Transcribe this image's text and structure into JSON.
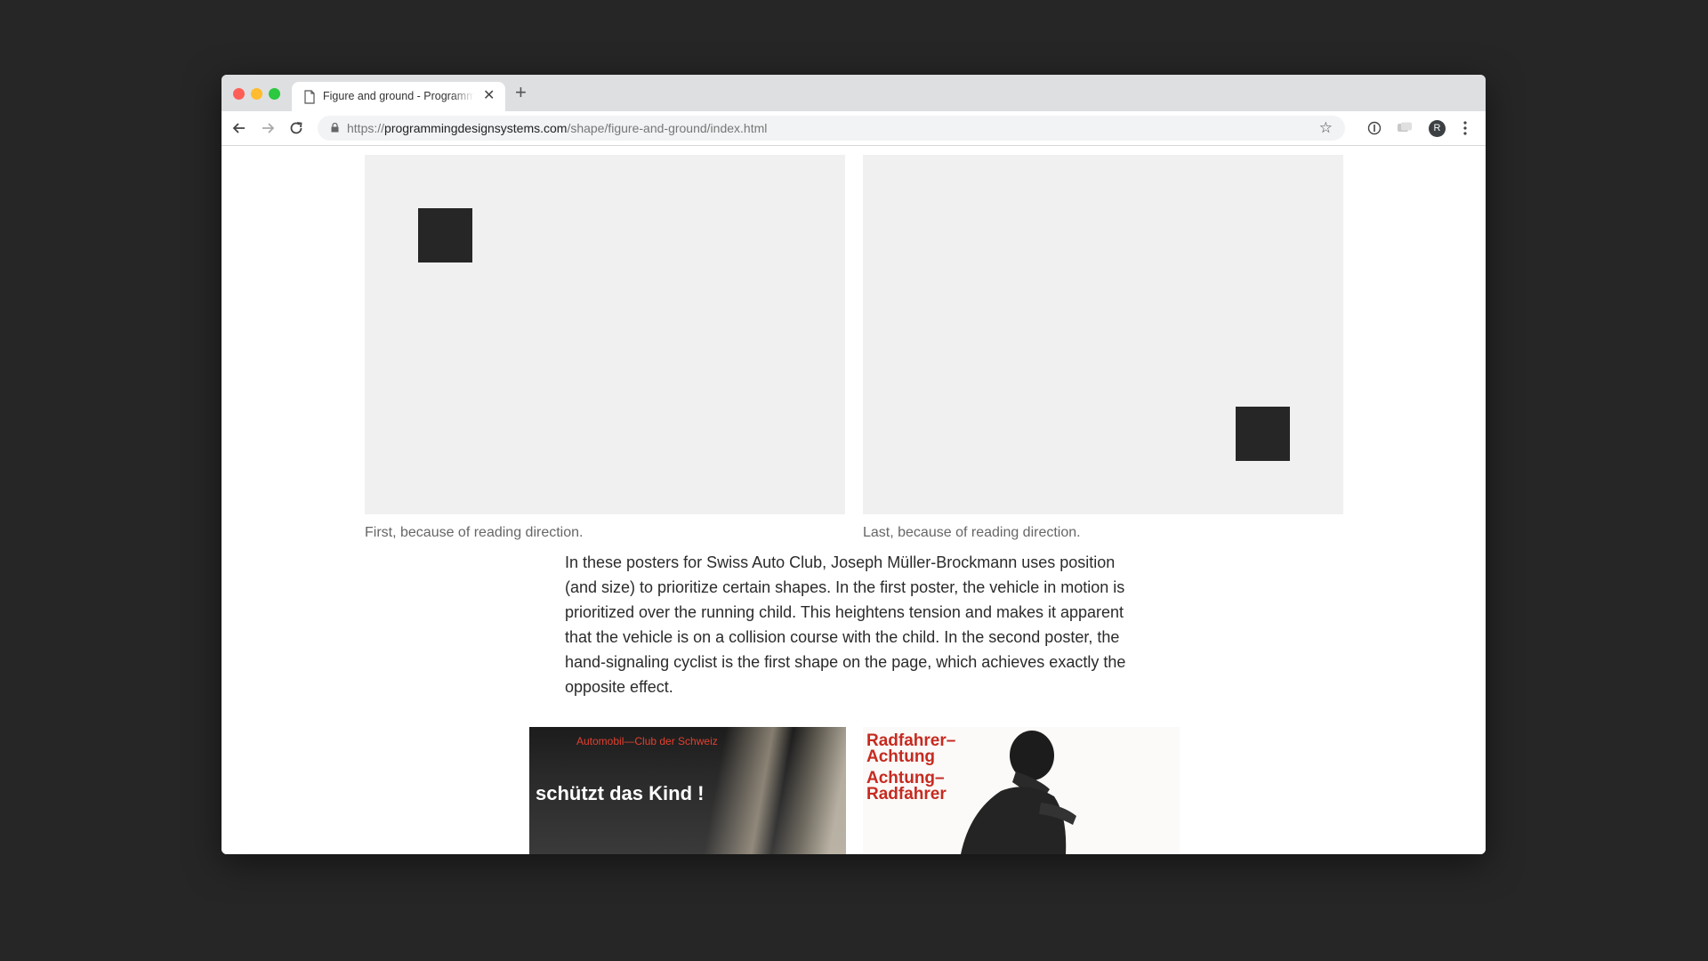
{
  "browser": {
    "tab": {
      "title": "Figure and ground - Programming Design Systems",
      "icon": "document-icon",
      "close_icon": "close-icon"
    },
    "new_tab_label": "+",
    "nav": {
      "back_icon": "back-arrow-icon",
      "forward_icon": "forward-arrow-icon",
      "reload_icon": "reload-icon"
    },
    "url": {
      "scheme": "https://",
      "host": "programmingdesignsystems.com",
      "path": "/shape/figure-and-ground/index.html"
    },
    "bookmark_icon": "star-icon",
    "star_glyph": "☆",
    "avatar_initial": "R",
    "colors": {
      "tab_strip": "#dedfe1",
      "omnibox": "#f1f3f4",
      "page_bg": "#262626"
    }
  },
  "page": {
    "figures": [
      {
        "caption": "First, because of reading direction."
      },
      {
        "caption": "Last, because of reading direction."
      }
    ],
    "paragraph": "In these posters for Swiss Auto Club, Joseph Müller-Brockmann uses position (and size) to prioritize certain shapes. In the first poster, the vehicle in motion is prioritized over the running child. This heightens tension and makes it apparent that the vehicle is on a collision course with the child. In the second poster, the hand-signaling cyclist is the first shape on the page, which achieves exactly the opposite effect.",
    "posters": [
      {
        "subtitle": "Automobil—Club der Schweiz",
        "headline": "schützt das Kind !"
      },
      {
        "lines": [
          "Radfahrer–",
          "Achtung",
          "Achtung–",
          "Radfahrer"
        ]
      }
    ],
    "colors": {
      "demo_bg": "#f0f0f0",
      "square": "#262626",
      "poster_red": "#c62a20"
    }
  }
}
